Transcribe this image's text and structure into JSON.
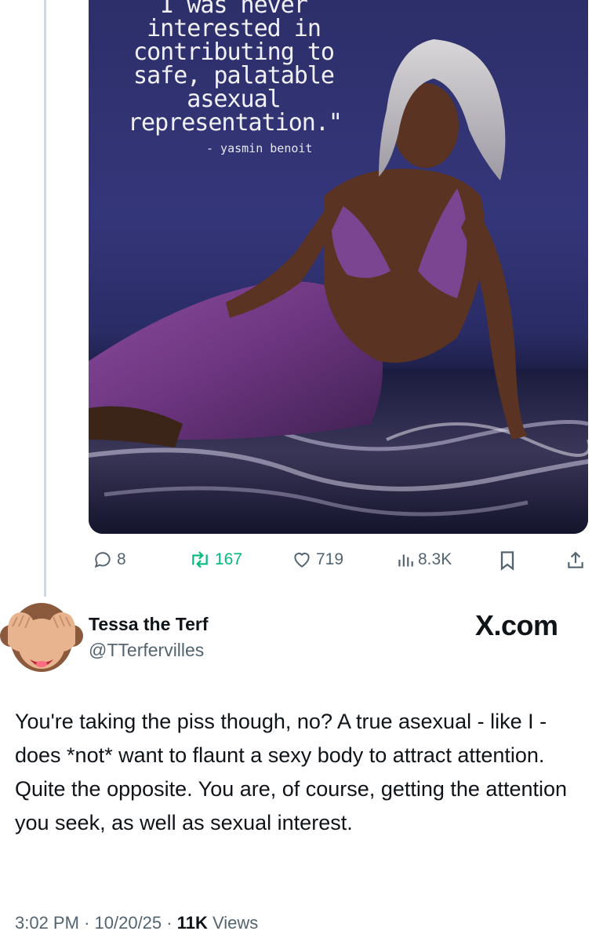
{
  "media": {
    "quote_lines": [
      "I was never",
      "interested in",
      "contributing to",
      "safe, palatable",
      "asexual",
      "representation.\""
    ],
    "quote_author": "- yasmin benoit"
  },
  "actions": {
    "replies": "8",
    "retweets": "167",
    "likes": "719",
    "views": "8.3K"
  },
  "reply": {
    "display_name": "Tessa the Terf",
    "handle": "@TTerfervilles",
    "watermark": "X.com",
    "text": "You're taking the piss though, no? A true asexual - like I - does *not* want to flaunt a sexy body to attract attention. Quite the opposite. You are, of course, getting the attention you seek, as well as sexual interest.",
    "time": "3:02 PM",
    "date": "10/20/25",
    "views_count": "11K",
    "views_label": "Views"
  },
  "icons": {
    "reply": "speech-bubble-icon",
    "retweet": "retweet-icon",
    "like": "heart-icon",
    "views": "bar-chart-icon",
    "bookmark": "bookmark-icon",
    "share": "share-icon",
    "avatar": "see-no-evil-monkey-emoji"
  },
  "colors": {
    "retweet_green": "#00ba7c",
    "secondary_text": "#536471",
    "primary_text": "#0f1419"
  }
}
